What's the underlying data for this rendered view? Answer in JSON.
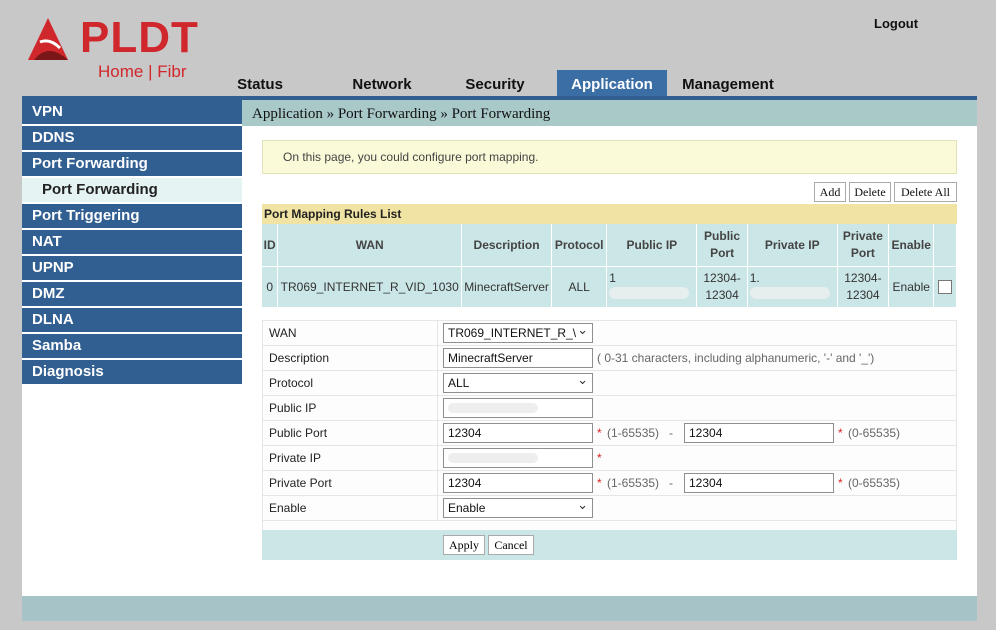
{
  "brand": {
    "name": "PLDT",
    "tagline": "Home | Fibr",
    "color": "#d0272d"
  },
  "header": {
    "logout": "Logout"
  },
  "tabs": [
    {
      "label": "Status",
      "active": false
    },
    {
      "label": "Network",
      "active": false
    },
    {
      "label": "Security",
      "active": false
    },
    {
      "label": "Application",
      "active": true
    },
    {
      "label": "Management",
      "active": false
    }
  ],
  "sidebar": [
    {
      "label": "VPN",
      "sub": false
    },
    {
      "label": "DDNS",
      "sub": false
    },
    {
      "label": "Port Forwarding",
      "sub": false
    },
    {
      "label": "Port Forwarding",
      "sub": true
    },
    {
      "label": "Port Triggering",
      "sub": false
    },
    {
      "label": "NAT",
      "sub": false
    },
    {
      "label": "UPNP",
      "sub": false
    },
    {
      "label": "DMZ",
      "sub": false
    },
    {
      "label": "DLNA",
      "sub": false
    },
    {
      "label": "Samba",
      "sub": false
    },
    {
      "label": "Diagnosis",
      "sub": false
    }
  ],
  "breadcrumb": "Application » Port Forwarding » Port Forwarding",
  "info": "On this page, you could configure port mapping.",
  "actions": {
    "add": "Add",
    "delete": "Delete",
    "delete_all": "Delete All"
  },
  "rules_list": {
    "title": "Port Mapping Rules List",
    "headers": [
      "ID",
      "WAN",
      "Description",
      "Protocol",
      "Public IP",
      "Public Port",
      "Private IP",
      "Private Port",
      "Enable"
    ],
    "rows": [
      {
        "id": "0",
        "wan": "TR069_INTERNET_R_VID_1030",
        "description": "MinecraftServer",
        "protocol": "ALL",
        "public_ip_prefix": "1",
        "public_port": "12304-12304",
        "private_ip_prefix": "1.",
        "private_port": "12304-12304",
        "enable": "Enable"
      }
    ]
  },
  "form": {
    "wan": {
      "label": "WAN",
      "value": "TR069_INTERNET_R_\\"
    },
    "description": {
      "label": "Description",
      "value": "MinecraftServer",
      "hint": "( 0-31 characters, including alphanumeric, '-' and '_')"
    },
    "protocol": {
      "label": "Protocol",
      "value": "ALL"
    },
    "public_ip": {
      "label": "Public IP",
      "value": ""
    },
    "public_port": {
      "label": "Public Port",
      "start": "12304",
      "range1": "(1-65535)",
      "dash": "-",
      "end": "12304",
      "range2": "(0-65535)"
    },
    "private_ip": {
      "label": "Private IP",
      "value": ""
    },
    "private_port": {
      "label": "Private Port",
      "start": "12304",
      "range1": "(1-65535)",
      "dash": "-",
      "end": "12304",
      "range2": "(0-65535)"
    },
    "enable": {
      "label": "Enable",
      "value": "Enable"
    },
    "star": "*"
  },
  "buttons": {
    "apply": "Apply",
    "cancel": "Cancel"
  }
}
